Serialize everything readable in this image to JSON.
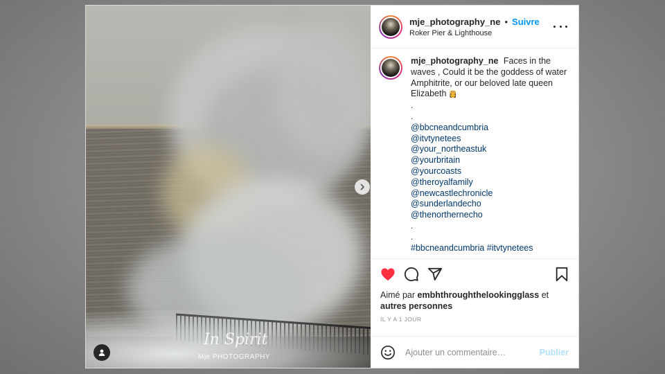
{
  "post": {
    "username": "mje_photography_ne",
    "separator": "•",
    "follow_label": "Suivre",
    "location": "Roker Pier & Lighthouse",
    "more_icon": "more-options-icon",
    "photo": {
      "signature": "In Spirit",
      "watermark": "Mje PHOTOGRAPHY",
      "next_icon": "chevron-right-icon",
      "user_tag_icon": "person-icon"
    },
    "caption": {
      "username": "mje_photography_ne",
      "text": "Faces in the waves , Could it be the goddess of water Amphitrite, or our beloved late queen Elizabeth",
      "emoji": "👸",
      "lines_before": [
        ".",
        "."
      ],
      "tags": [
        "@bbcneandcumbria",
        "@itvtynetees",
        "@your_northeastuk",
        "@yourbritain",
        "@yourcoasts",
        "@theroyalfamily",
        "@newcastlechronicle",
        "@sunderlandecho",
        "@thenorthernecho"
      ],
      "lines_after": [
        ".",
        "."
      ],
      "hashtags": "#bbcneandcumbria #itvtynetees"
    },
    "actions": {
      "like_icon": "heart-icon",
      "comment_icon": "comment-icon",
      "share_icon": "send-icon",
      "save_icon": "bookmark-icon",
      "like_color": "#ff3040"
    },
    "likes": {
      "prefix": "Aimé par",
      "user": "embhthroughthelookingglass",
      "connector": "et",
      "others": "autres personnes"
    },
    "timestamp": "IL Y A 1 JOUR",
    "comment": {
      "emoji_icon": "smiley-icon",
      "placeholder": "Ajouter un commentaire…",
      "publish_label": "Publier"
    }
  }
}
